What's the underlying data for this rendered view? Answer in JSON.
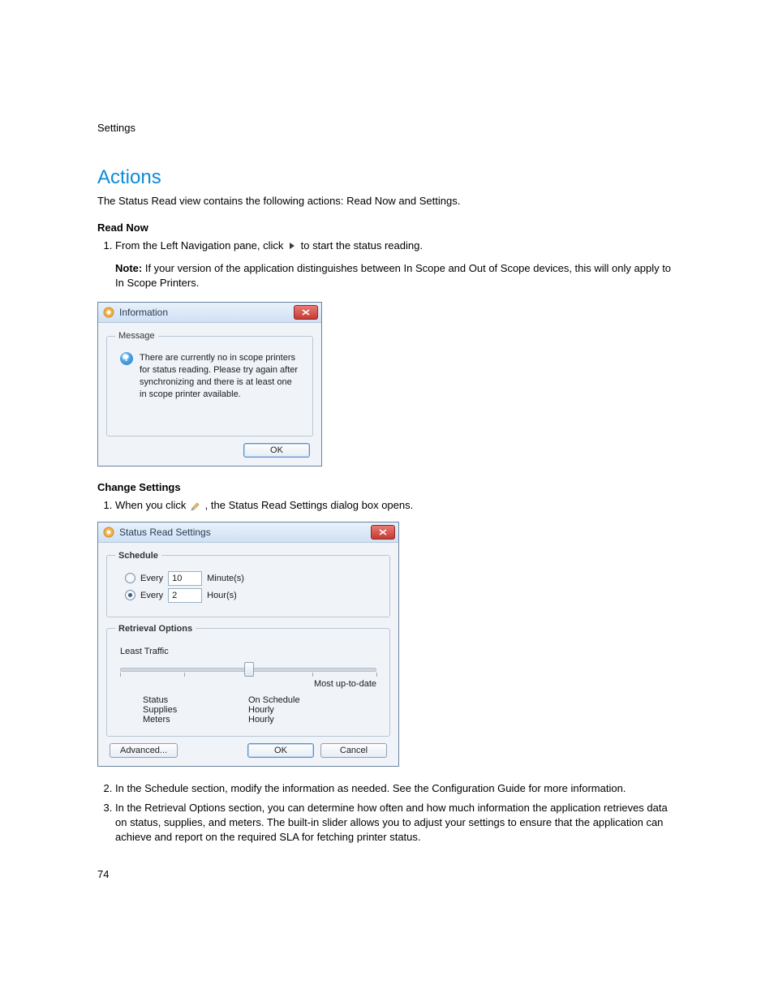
{
  "doc": {
    "header": "Settings",
    "page_number": "74"
  },
  "section": {
    "title": "Actions",
    "intro": "The Status Read view contains the following actions: Read Now and Settings."
  },
  "read_now": {
    "heading": "Read Now",
    "step1_pre": "From the Left Navigation pane, click ",
    "step1_post": " to start the status reading.",
    "note_label": "Note:",
    "note_text": " If your version of the application distinguishes between In Scope and Out of Scope devices, this will only apply to In Scope Printers."
  },
  "info_dialog": {
    "title": "Information",
    "group_legend": "Message",
    "message": "There are currently no in scope printers for status reading. Please try again after synchronizing and there is at least one in scope printer available.",
    "ok": "OK"
  },
  "change_settings": {
    "heading": "Change Settings",
    "step1_pre": "When you click ",
    "step1_post": ", the Status Read Settings dialog box opens.",
    "step2": "In the Schedule section, modify the information as needed. See the Configuration Guide for more information.",
    "step3": "In the Retrieval Options section, you can determine how often and how much information the application retrieves data on status, supplies, and meters. The built-in slider allows you to adjust your settings to ensure that the application can achieve and report on the required SLA for fetching printer status."
  },
  "settings_dialog": {
    "title": "Status Read Settings",
    "schedule_legend": "Schedule",
    "every_label": "Every",
    "minutes_value": "10",
    "minutes_unit": "Minute(s)",
    "hours_value": "2",
    "hours_unit": "Hour(s)",
    "retrieval_legend": "Retrieval Options",
    "least_traffic": "Least Traffic",
    "most_uptodate": "Most up-to-date",
    "rows": {
      "status_label": "Status",
      "status_value": "On Schedule",
      "supplies_label": "Supplies",
      "supplies_value": "Hourly",
      "meters_label": "Meters",
      "meters_value": "Hourly"
    },
    "advanced": "Advanced...",
    "ok": "OK",
    "cancel": "Cancel"
  }
}
